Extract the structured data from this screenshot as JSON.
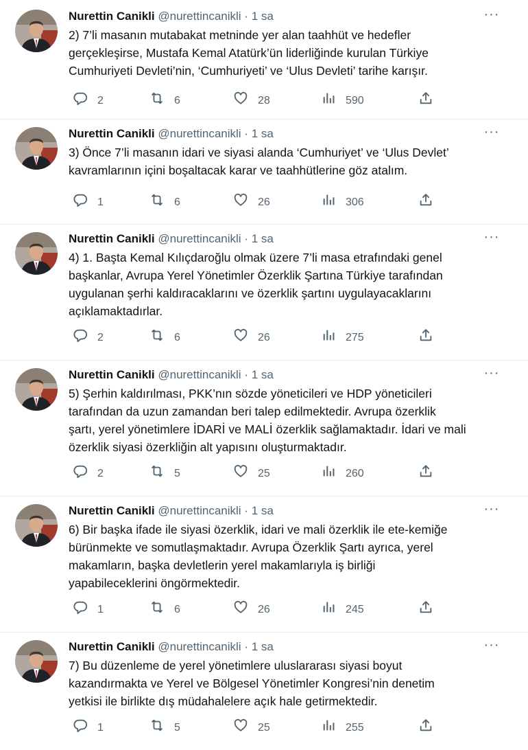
{
  "colors": {
    "text": "#0f1419",
    "muted": "#536471",
    "divider": "#e6ecf0"
  },
  "icons": {
    "more": "more-icon",
    "reply": "reply-icon",
    "retweet": "retweet-icon",
    "like": "heart-icon",
    "views": "views-icon",
    "share": "share-icon"
  },
  "tweets": [
    {
      "name": "Nurettin Canikli",
      "handle": "@nurettincanikli",
      "dot": "·",
      "time": "1 sa",
      "more": "···",
      "lines": [
        "2) 7’li masanın mutabakat metninde yer alan taahhüt ve hedefler",
        "gerçekleşirse, Mustafa Kemal Atatürk’ün liderliğinde kurulan Türkiye",
        "Cumhuriyeti Devleti’nin, ‘Cumhuriyeti’ ve ‘Ulus Devleti’ tarihe karışır."
      ],
      "replies": "2",
      "retweets": "6",
      "likes": "28",
      "views": "590"
    },
    {
      "name": "Nurettin Canikli",
      "handle": "@nurettincanikli",
      "dot": "·",
      "time": "1 sa",
      "more": "···",
      "lines": [
        "3) Önce 7’li masanın idari ve siyasi alanda ‘Cumhuriyet’ ve ‘Ulus Devlet’",
        "kavramlarının içini boşaltacak karar ve taahhütlerine göz atalım."
      ],
      "replies": "1",
      "retweets": "6",
      "likes": "26",
      "views": "306"
    },
    {
      "name": "Nurettin Canikli",
      "handle": "@nurettincanikli",
      "dot": "·",
      "time": "1 sa",
      "more": "···",
      "lines": [
        "4) 1. Başta Kemal Kılıçdaroğlu olmak üzere 7’li masa etrafındaki genel",
        "başkanlar, Avrupa Yerel Yönetimler Özerklik Şartına Türkiye tarafından",
        "uygulanan şerhi kaldıracaklarını ve özerklik şartını uygulayacaklarını",
        "açıklamaktadırlar."
      ],
      "replies": "2",
      "retweets": "6",
      "likes": "26",
      "views": "275"
    },
    {
      "name": "Nurettin Canikli",
      "handle": "@nurettincanikli",
      "dot": "·",
      "time": "1 sa",
      "more": "···",
      "lines": [
        "5) Şerhin kaldırılması, PKK’nın sözde yöneticileri ve HDP yöneticileri",
        "tarafından da uzun zamandan beri talep edilmektedir. Avrupa özerklik",
        "şartı, yerel yönetimlere İDARİ ve MALİ özerklik sağlamaktadır. İdari ve mali",
        "özerklik siyasi özerkliğin alt yapısını oluşturmaktadır."
      ],
      "replies": "2",
      "retweets": "5",
      "likes": "25",
      "views": "260"
    },
    {
      "name": "Nurettin Canikli",
      "handle": "@nurettincanikli",
      "dot": "·",
      "time": "1 sa",
      "more": "···",
      "lines": [
        "6) Bir başka ifade ile siyasi özerklik, idari ve mali özerklik ile ete-kemiğe",
        "bürünmekte ve somutlaşmaktadır. Avrupa Özerklik Şartı ayrıca, yerel",
        "makamların, başka devletlerin yerel makamlarıyla iş birliği",
        "yapabileceklerini öngörmektedir."
      ],
      "replies": "1",
      "retweets": "6",
      "likes": "26",
      "views": "245"
    },
    {
      "name": "Nurettin Canikli",
      "handle": "@nurettincanikli",
      "dot": "·",
      "time": "1 sa",
      "more": "···",
      "lines": [
        "7) Bu düzenleme de yerel yönetimlere uluslararası siyasi boyut",
        "kazandırmakta ve Yerel ve Bölgesel Yönetimler Kongresi’nin denetim",
        "yetkisi ile birlikte dış müdahalelere açık hale getirmektedir."
      ],
      "replies": "1",
      "retweets": "5",
      "likes": "25",
      "views": "255"
    }
  ]
}
